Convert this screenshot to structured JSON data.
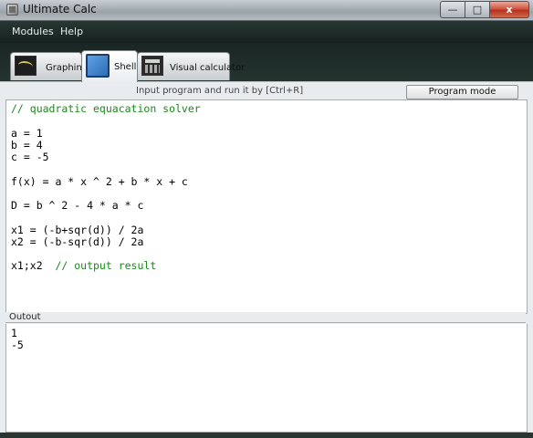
{
  "window": {
    "title": "Ultimate Calc",
    "minimize": "—",
    "maximize": "□",
    "close": "x"
  },
  "menu": {
    "modules": "Modules",
    "help": "Help"
  },
  "tabs": [
    {
      "label": "Graphing",
      "icon": "graph-icon"
    },
    {
      "label": "Shell",
      "icon": "shell-icon"
    },
    {
      "label": "Visual calculator",
      "icon": "calculator-icon"
    }
  ],
  "hint": "Input program and run it by [Ctrl+R]",
  "mode_button": "Program mode",
  "editor": {
    "lines": [
      {
        "code": "",
        "comment": "// quadratic equacation solver"
      },
      {
        "code": "",
        "comment": ""
      },
      {
        "code": "a = 1",
        "comment": ""
      },
      {
        "code": "b = 4",
        "comment": ""
      },
      {
        "code": "c = -5",
        "comment": ""
      },
      {
        "code": "",
        "comment": ""
      },
      {
        "code": "f(x) = a * x ^ 2 + b * x + c",
        "comment": ""
      },
      {
        "code": "",
        "comment": ""
      },
      {
        "code": "D = b ^ 2 - 4 * a * c",
        "comment": ""
      },
      {
        "code": "",
        "comment": ""
      },
      {
        "code": "x1 = (-b+sqr(d)) / 2a",
        "comment": ""
      },
      {
        "code": "x2 = (-b-sqr(d)) / 2a",
        "comment": ""
      },
      {
        "code": "",
        "comment": ""
      },
      {
        "code": "x1;x2  ",
        "comment": "// output result"
      }
    ]
  },
  "output": {
    "label": "Outout",
    "lines": [
      "1",
      "-5"
    ]
  }
}
